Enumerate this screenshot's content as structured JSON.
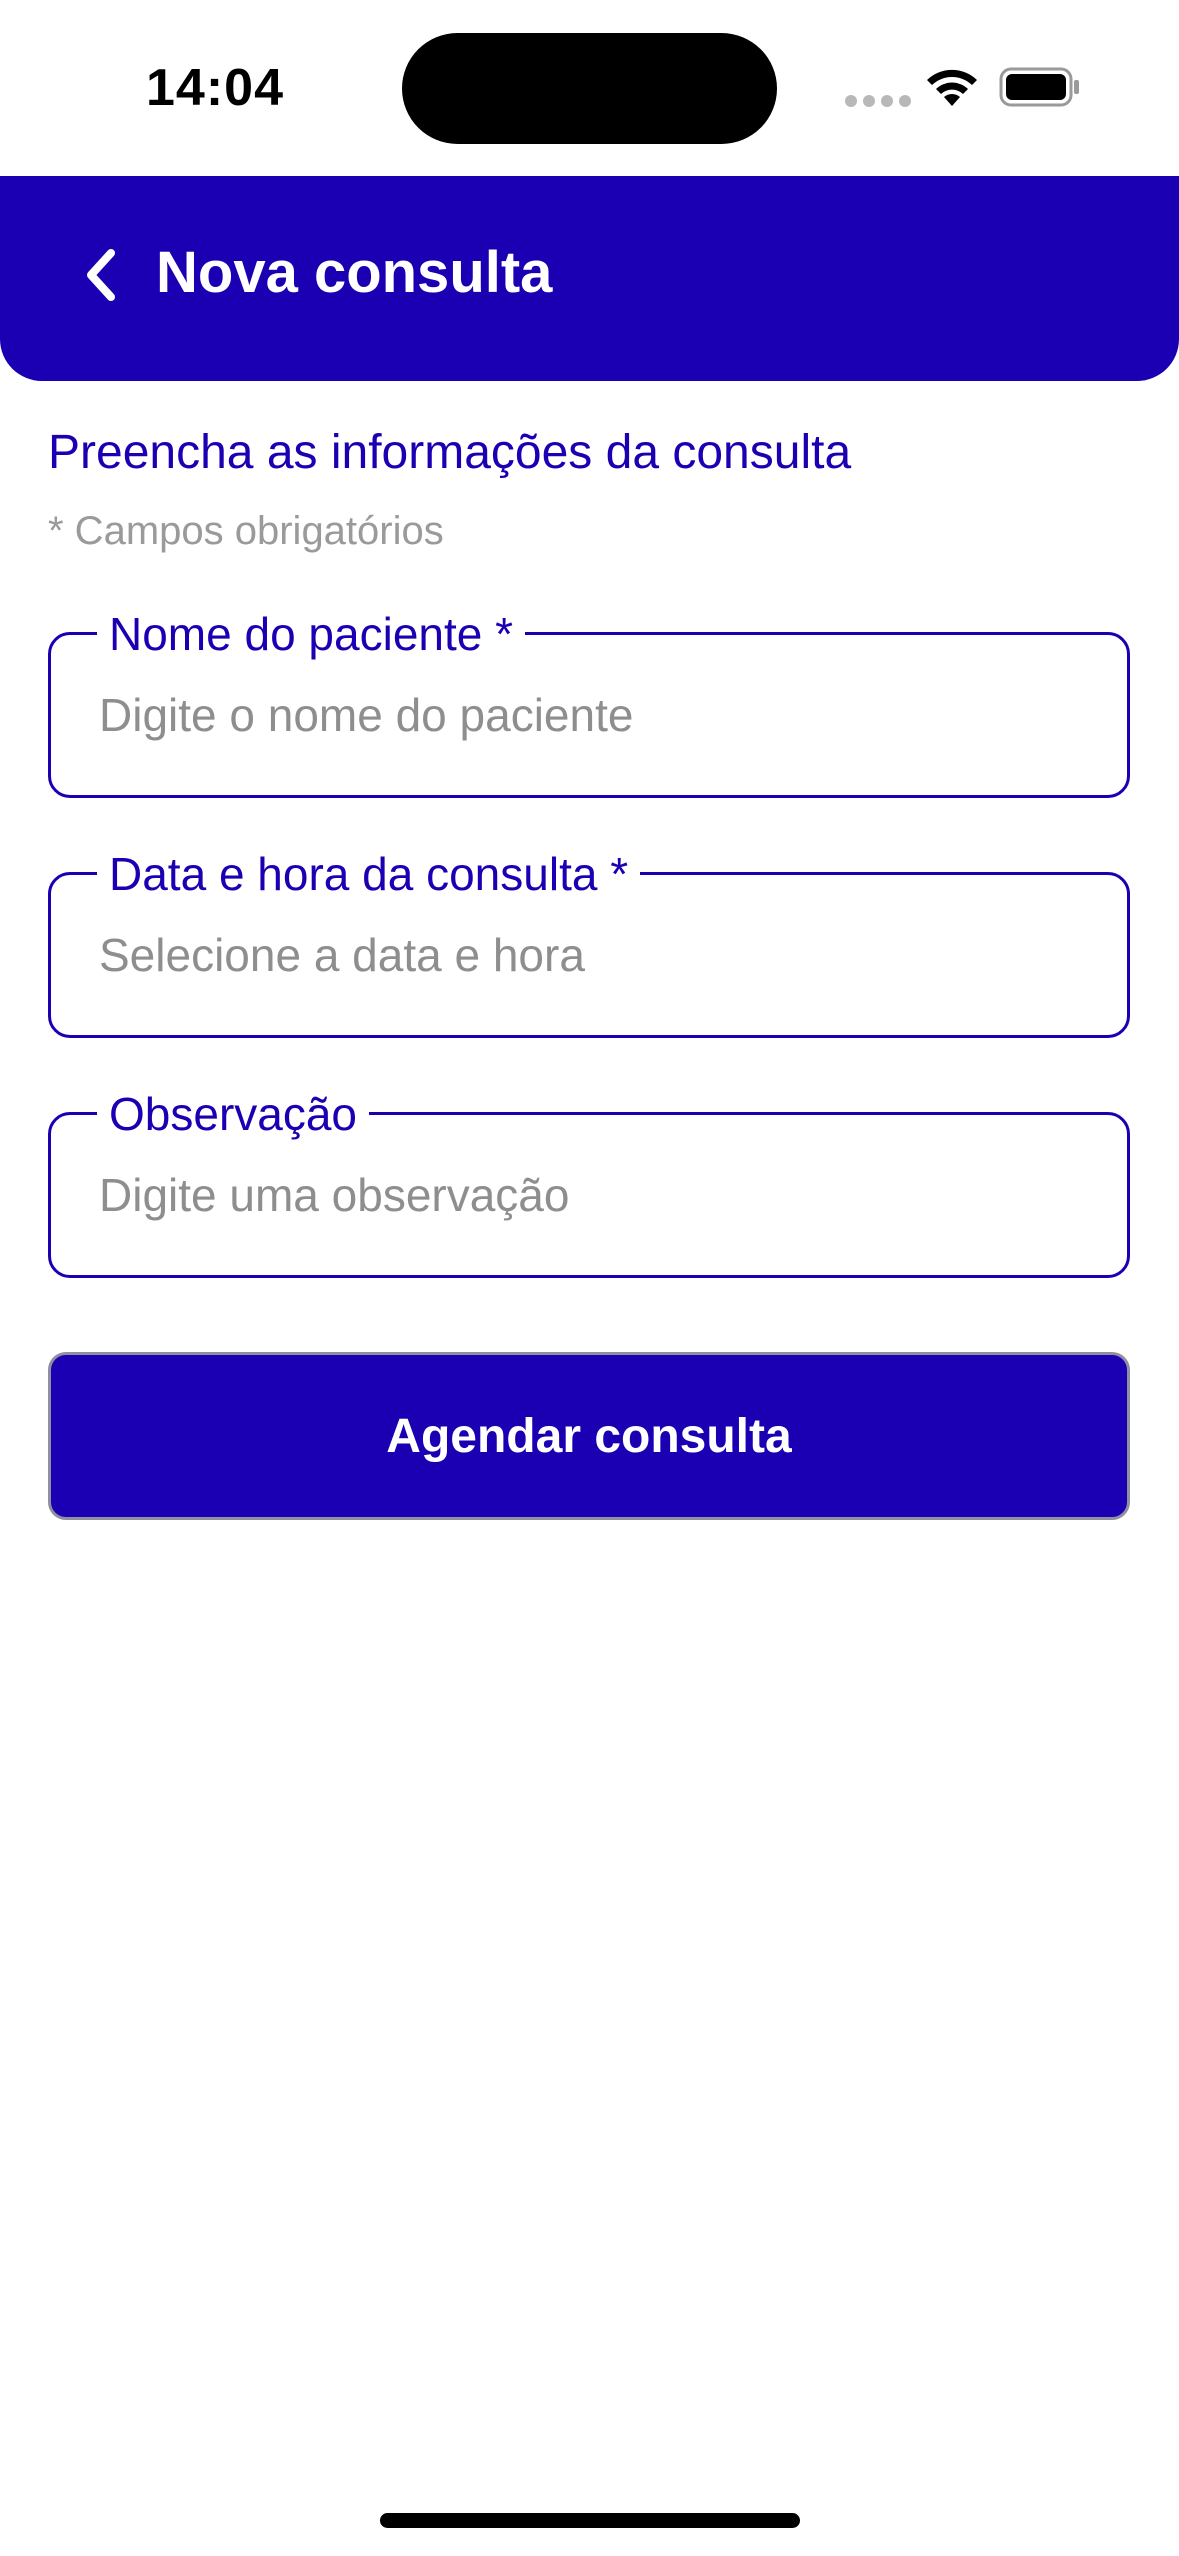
{
  "status_bar": {
    "time": "14:04",
    "icons": [
      "signal-dots-icon",
      "wifi-icon",
      "battery-icon"
    ]
  },
  "header": {
    "back_icon": "chevron-left-icon",
    "title": "Nova consulta",
    "background_color": "#1b00b3"
  },
  "form": {
    "intro": "Preencha as informações da consulta",
    "required_note": "* Campos obrigatórios",
    "fields": [
      {
        "label": "Nome do paciente *",
        "placeholder": "Digite o nome do paciente",
        "value": ""
      },
      {
        "label": "Data e hora da consulta *",
        "placeholder": "Selecione a data e hora",
        "value": ""
      },
      {
        "label": "Observação",
        "placeholder": "Digite uma observação",
        "value": ""
      }
    ],
    "submit_label": "Agendar consulta"
  },
  "colors": {
    "accent": "#1b00b3",
    "placeholder": "#8e8e8e",
    "muted_text": "#9a9a9a"
  }
}
